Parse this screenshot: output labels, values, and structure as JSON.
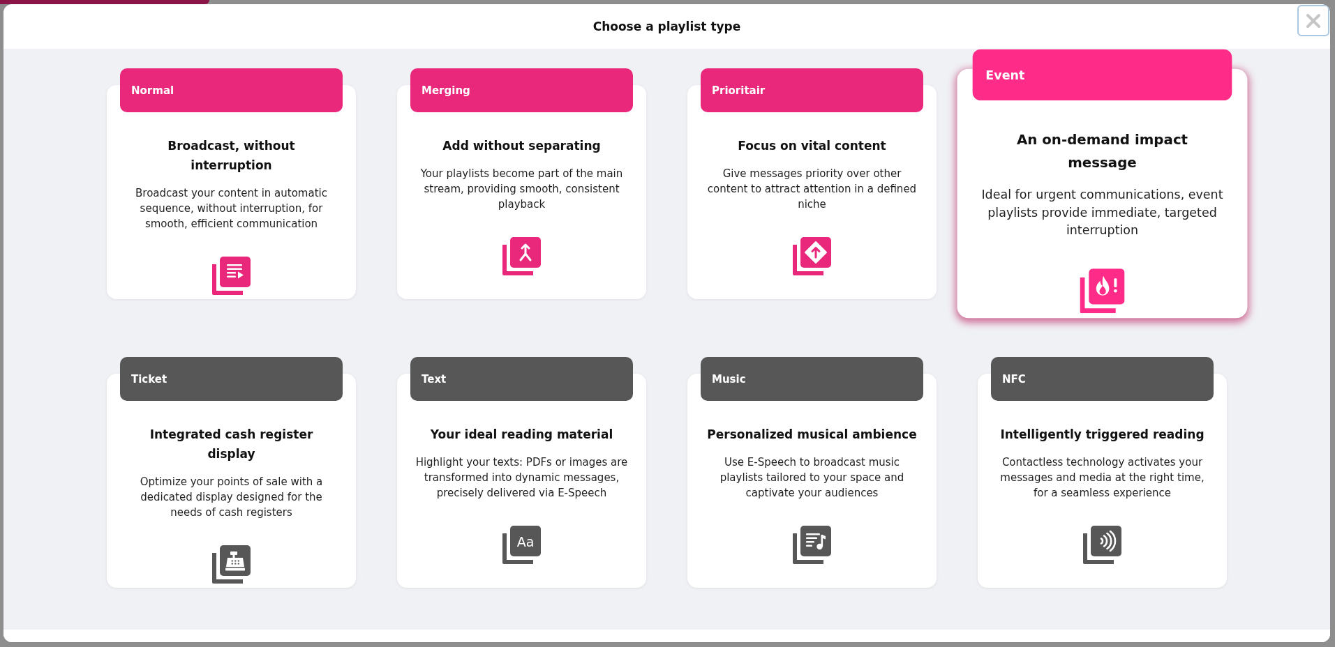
{
  "dialog": {
    "title": "Choose a playlist type"
  },
  "playlist_types": [
    {
      "label": "Normal",
      "title": "Broadcast, without interruption",
      "description": "Broadcast your content in automatic sequence, without interruption, for smooth, efficient communication",
      "color": "#e9277b",
      "selected": false
    },
    {
      "label": "Merging",
      "title": "Add without separating",
      "description": "Your playlists become part of the main stream, providing smooth, consistent playback",
      "color": "#e9277b",
      "selected": false
    },
    {
      "label": "Prioritair",
      "title": "Focus on vital content",
      "description": "Give messages priority over other content to attract attention in a defined niche",
      "color": "#e9277b",
      "selected": false
    },
    {
      "label": "Event",
      "title": "An on-demand impact message",
      "description": "Ideal for urgent communications, event playlists provide immediate, targeted interruption",
      "color": "#ff2b88",
      "selected": true
    },
    {
      "label": "Ticket",
      "title": "Integrated cash register display",
      "description": "Optimize your points of sale with a dedicated display designed for the needs of cash registers",
      "color": "#575757",
      "selected": false
    },
    {
      "label": "Text",
      "title": "Your ideal reading material",
      "description": "Highlight your texts: PDFs or images are transformed into dynamic messages, precisely delivered via E-Speech",
      "color": "#575757",
      "selected": false,
      "icon_text": "Aa"
    },
    {
      "label": "Music",
      "title": "Personalized musical ambience",
      "description": "Use E-Speech to broadcast music playlists tailored to your space and captivate your audiences",
      "color": "#575757",
      "selected": false
    },
    {
      "label": "NFC",
      "title": "Intelligently triggered reading",
      "description": "Contactless technology activates your messages and media at the right time, for a seamless experience",
      "color": "#575757",
      "selected": false
    }
  ]
}
